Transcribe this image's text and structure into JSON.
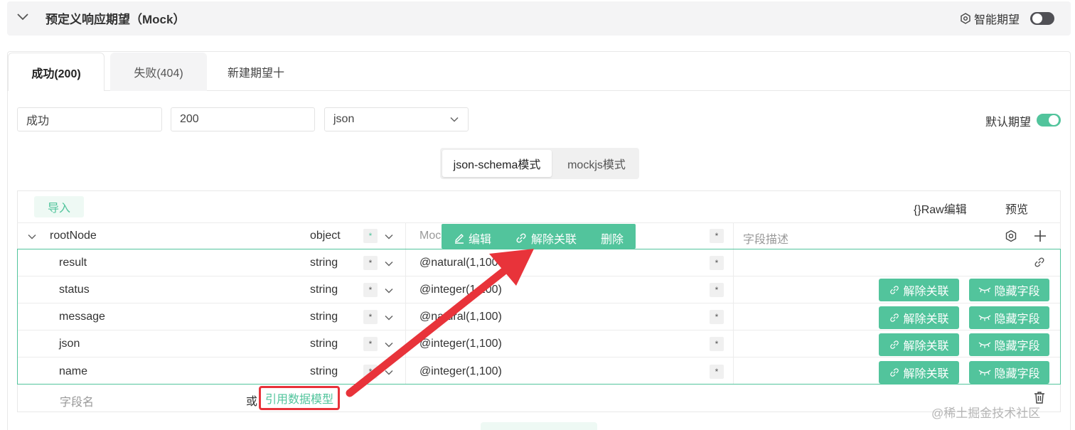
{
  "header": {
    "title": "预定义响应期望（Mock）",
    "smart_label": "智能期望",
    "smart_enabled": false
  },
  "tabs": [
    {
      "label": "成功(200)",
      "active": true
    },
    {
      "label": "失败(404)",
      "active": false
    },
    {
      "label": "新建期望十",
      "active": false
    }
  ],
  "form": {
    "name_value": "成功",
    "code_value": "200",
    "type_value": "json",
    "default_label": "默认期望",
    "default_enabled": true
  },
  "mode": {
    "schema_label": "json-schema模式",
    "mockjs_label": "mockjs模式"
  },
  "toolbar": {
    "import_label": "导入",
    "raw_label": "{}Raw编辑",
    "preview_label": "预览"
  },
  "root": {
    "name": "rootNode",
    "type": "object",
    "required": "*",
    "mock_placeholder": "Moc",
    "desc_placeholder": "字段描述"
  },
  "popup": {
    "edit": "编辑",
    "unlink": "解除关联",
    "delete": "删除"
  },
  "fields": [
    {
      "name": "result",
      "type": "string",
      "required": "*",
      "mock": "@natural(1,100",
      "flag": "*"
    },
    {
      "name": "status",
      "type": "string",
      "required": "*",
      "mock": "@integer(1,100)",
      "flag": "*"
    },
    {
      "name": "message",
      "type": "string",
      "required": "*",
      "mock": "@natural(1,100)",
      "flag": "*"
    },
    {
      "name": "json",
      "type": "string",
      "required": "*",
      "mock": "@integer(1,100)",
      "flag": "*"
    },
    {
      "name": "name",
      "type": "string",
      "required": "*",
      "mock": "@integer(1,100)",
      "flag": "*"
    }
  ],
  "row_actions": {
    "unlink": "解除关联",
    "hide": "隐藏字段"
  },
  "footer": {
    "field_placeholder": "字段名",
    "or_label": "或",
    "ref_model": "引用数据模型"
  },
  "watermark": "@稀土掘金技术社区",
  "colors": {
    "accent": "#52c49c",
    "highlight": "#e8333a"
  }
}
